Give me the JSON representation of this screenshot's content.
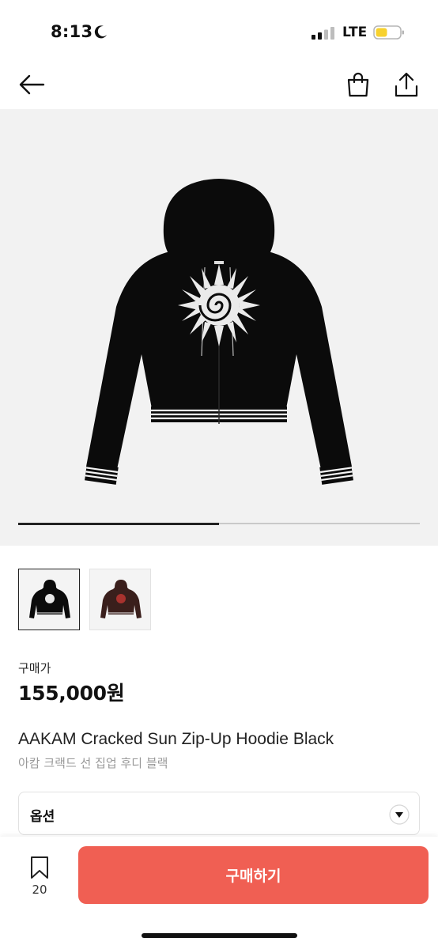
{
  "status_bar": {
    "time": "8:13",
    "carrier": "LTE"
  },
  "icons": {
    "back": "arrow-left-icon",
    "bag": "shopping-bag-icon",
    "share": "share-icon",
    "bookmark": "bookmark-icon",
    "chevron": "chevron-down-icon",
    "moon": "moon-icon",
    "signal": "signal-icon",
    "battery": "battery-icon"
  },
  "colors": {
    "accent": "#f05f53",
    "battery": "#f7d12e"
  },
  "gallery": {
    "progress": 0.5,
    "thumbnails": [
      "black",
      "brown"
    ]
  },
  "product": {
    "price_label": "구매가",
    "price": "155,000원",
    "name": "AAKAM Cracked Sun Zip-Up Hoodie Black",
    "name_kr": "아캄 크랙드 선 집업 후디 블랙"
  },
  "option": {
    "label": "옵션"
  },
  "bottom": {
    "bookmark_count": "20",
    "buy_label": "구매하기"
  }
}
